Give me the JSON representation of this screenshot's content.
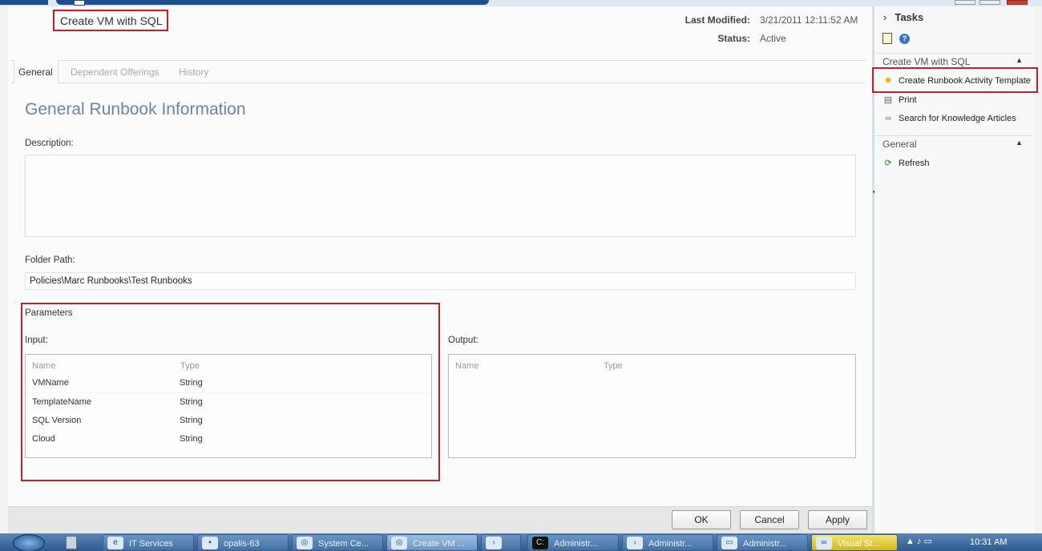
{
  "window": {
    "title": "Create VM with SQL",
    "last_modified_label": "Last Modified:",
    "last_modified_value": "3/21/2011 12:11:52 AM",
    "status_label": "Status:",
    "status_value": "Active"
  },
  "tabs": [
    {
      "label": "General",
      "active": true
    },
    {
      "label": "Dependent Offerings",
      "active": false
    },
    {
      "label": "History",
      "active": false
    }
  ],
  "general": {
    "section_title": "General Runbook Information",
    "description_label": "Description:",
    "description_value": "",
    "folder_label": "Folder Path:",
    "folder_value": "Policies\\Marc Runbooks\\Test Runbooks"
  },
  "parameters": {
    "title": "Parameters",
    "input_label": "Input:",
    "output_label": "Output:",
    "columns": [
      "Name",
      "Type"
    ],
    "input_rows": [
      {
        "name": "VMName",
        "type": "String"
      },
      {
        "name": "TemplateName",
        "type": "String"
      },
      {
        "name": "SQL Version",
        "type": "String"
      },
      {
        "name": "Cloud",
        "type": "String"
      }
    ]
  },
  "buttons": {
    "ok": "OK",
    "cancel": "Cancel",
    "apply": "Apply"
  },
  "tasks": {
    "header": "Tasks",
    "group1_title": "Create VM with SQL",
    "group1_items": [
      {
        "label": "Create Runbook Activity Template",
        "icon": "sun-icon"
      },
      {
        "label": "Print",
        "icon": "printer-icon"
      },
      {
        "label": "Search for Knowledge Articles",
        "icon": "link-icon"
      }
    ],
    "group2_title": "General",
    "group2_items": [
      {
        "label": "Refresh",
        "icon": "refresh-icon"
      }
    ]
  },
  "taskbar": {
    "items": [
      {
        "label": "IT Services"
      },
      {
        "label": "opalis-63"
      },
      {
        "label": "System Ce..."
      },
      {
        "label": "Create VM ..."
      },
      {
        "label": ""
      },
      {
        "label": "Administr..."
      },
      {
        "label": "Administr..."
      },
      {
        "label": "Administr..."
      },
      {
        "label": "Visual St..."
      }
    ],
    "clock": "10:31 AM"
  },
  "colors": {
    "highlight_red": "#c0202a",
    "section_title": "#6b84a6",
    "taskbar": "#2e5a8f"
  }
}
